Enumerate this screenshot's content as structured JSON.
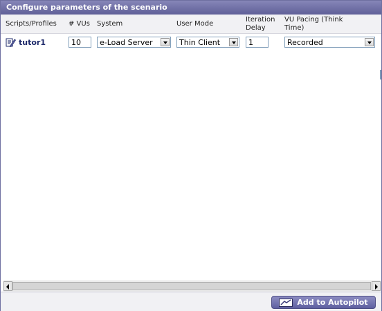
{
  "panel": {
    "title": "Configure parameters of the scenario"
  },
  "headers": {
    "scripts": "Scripts/Profiles",
    "vus": "# VUs",
    "system": "System",
    "user_mode": "User Mode",
    "iteration_delay_line1": "Iteration",
    "iteration_delay_line2": "Delay",
    "vu_pacing_line1": "VU Pacing (Think",
    "vu_pacing_line2": "Time)"
  },
  "row": {
    "script_name": "tutor1",
    "script_icon": "script-edit-icon",
    "vus": "10",
    "system": "e-Load Server",
    "user_mode": "Thin Client",
    "iteration_delay": "1",
    "vu_pacing": "Recorded"
  },
  "footer": {
    "add_button_label": "Add to Autopilot"
  },
  "colors": {
    "title_bar": "#6f6fa8",
    "header_bg": "#f1f1f4",
    "button": "#6b6bab",
    "script_label": "#1f2b6b"
  }
}
